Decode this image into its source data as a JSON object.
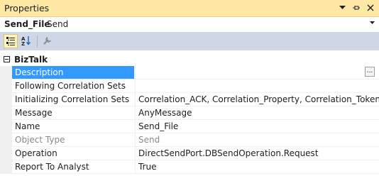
{
  "window": {
    "title": "Properties"
  },
  "object": {
    "name": "Send_File",
    "type": "Send"
  },
  "toolbar": {
    "categorized_icon": "categorized-icon",
    "alphabetical_icon": "alphabetical-icon",
    "property_pages_icon": "wrench-icon"
  },
  "category": {
    "label": "BizTalk"
  },
  "properties": [
    {
      "name": "Description",
      "value": ""
    },
    {
      "name": "Following Correlation Sets",
      "value": ""
    },
    {
      "name": "Initializing Correlation Sets",
      "value": "Correlation_ACK, Correlation_Property, Correlation_Token"
    },
    {
      "name": "Message",
      "value": "AnyMessage"
    },
    {
      "name": "Name",
      "value": "Send_File"
    },
    {
      "name": "Object Type",
      "value": "Send"
    },
    {
      "name": "Operation",
      "value": "DirectSendPort.DBSendOperation.Request"
    },
    {
      "name": "Report To Analyst",
      "value": "True"
    }
  ],
  "description_editor": {
    "label": "..."
  },
  "colors": {
    "title_bar": "#ffe8a6",
    "toolbar": "#cfd6e5",
    "selection": "#3399ff",
    "disabled_text": "#8a8a8a"
  }
}
